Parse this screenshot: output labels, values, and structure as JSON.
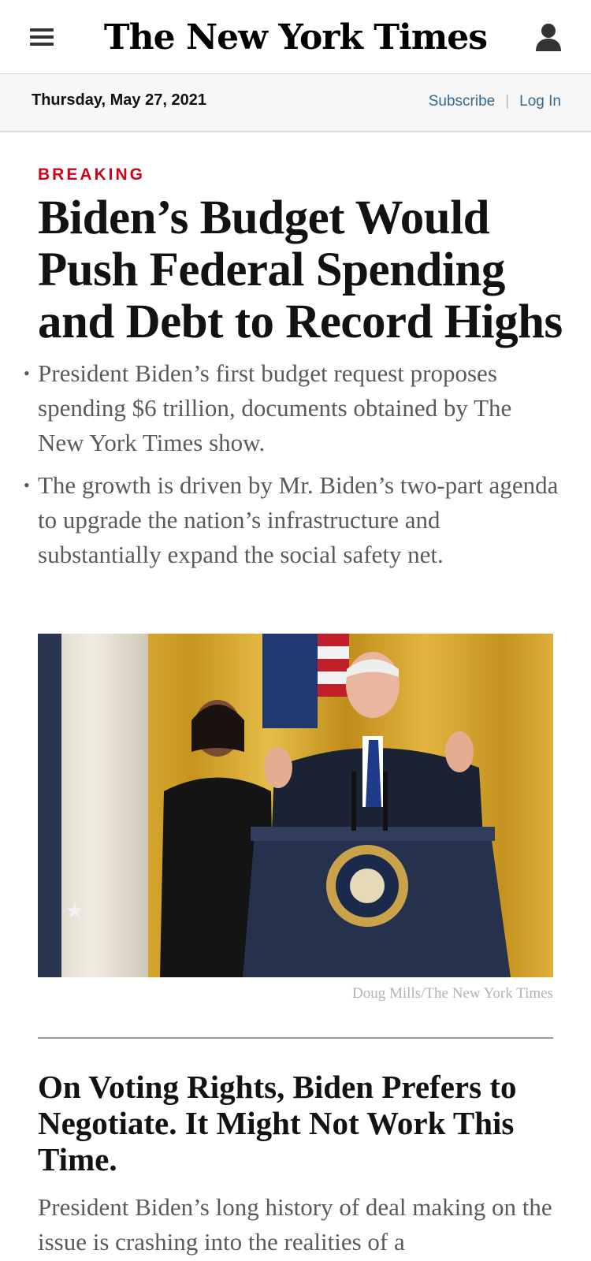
{
  "header": {
    "logo_text": "The New York Times",
    "menu_icon": "hamburger-menu-icon",
    "account_icon": "user-account-icon"
  },
  "datebar": {
    "date": "Thursday, May 27, 2021",
    "subscribe_label": "Subscribe",
    "separator": "|",
    "login_label": "Log In"
  },
  "lead_story": {
    "kicker": "BREAKING",
    "headline": "Biden’s Budget Would Push Federal Spending and Debt to Record Highs",
    "summary": [
      "President Biden’s first budget request proposes spending $6 trillion, documents obtained by The New York Times show.",
      "The growth is driven by Mr. Biden’s two-part agenda to upgrade the nation’s infrastructure and substantially expand the social safety net."
    ],
    "photo_credit": "Doug Mills/The New York Times"
  },
  "second_story": {
    "headline": "On Voting Rights, Biden Prefers to Negotiate. It Might Not Work This Time.",
    "summary": "President Biden’s long history of deal making on the issue is crashing into the realities of a"
  },
  "colors": {
    "kicker": "#d0021b",
    "link": "#326891",
    "summary_text": "#5a5a5a",
    "datebar_bg": "#f7f7f7"
  }
}
